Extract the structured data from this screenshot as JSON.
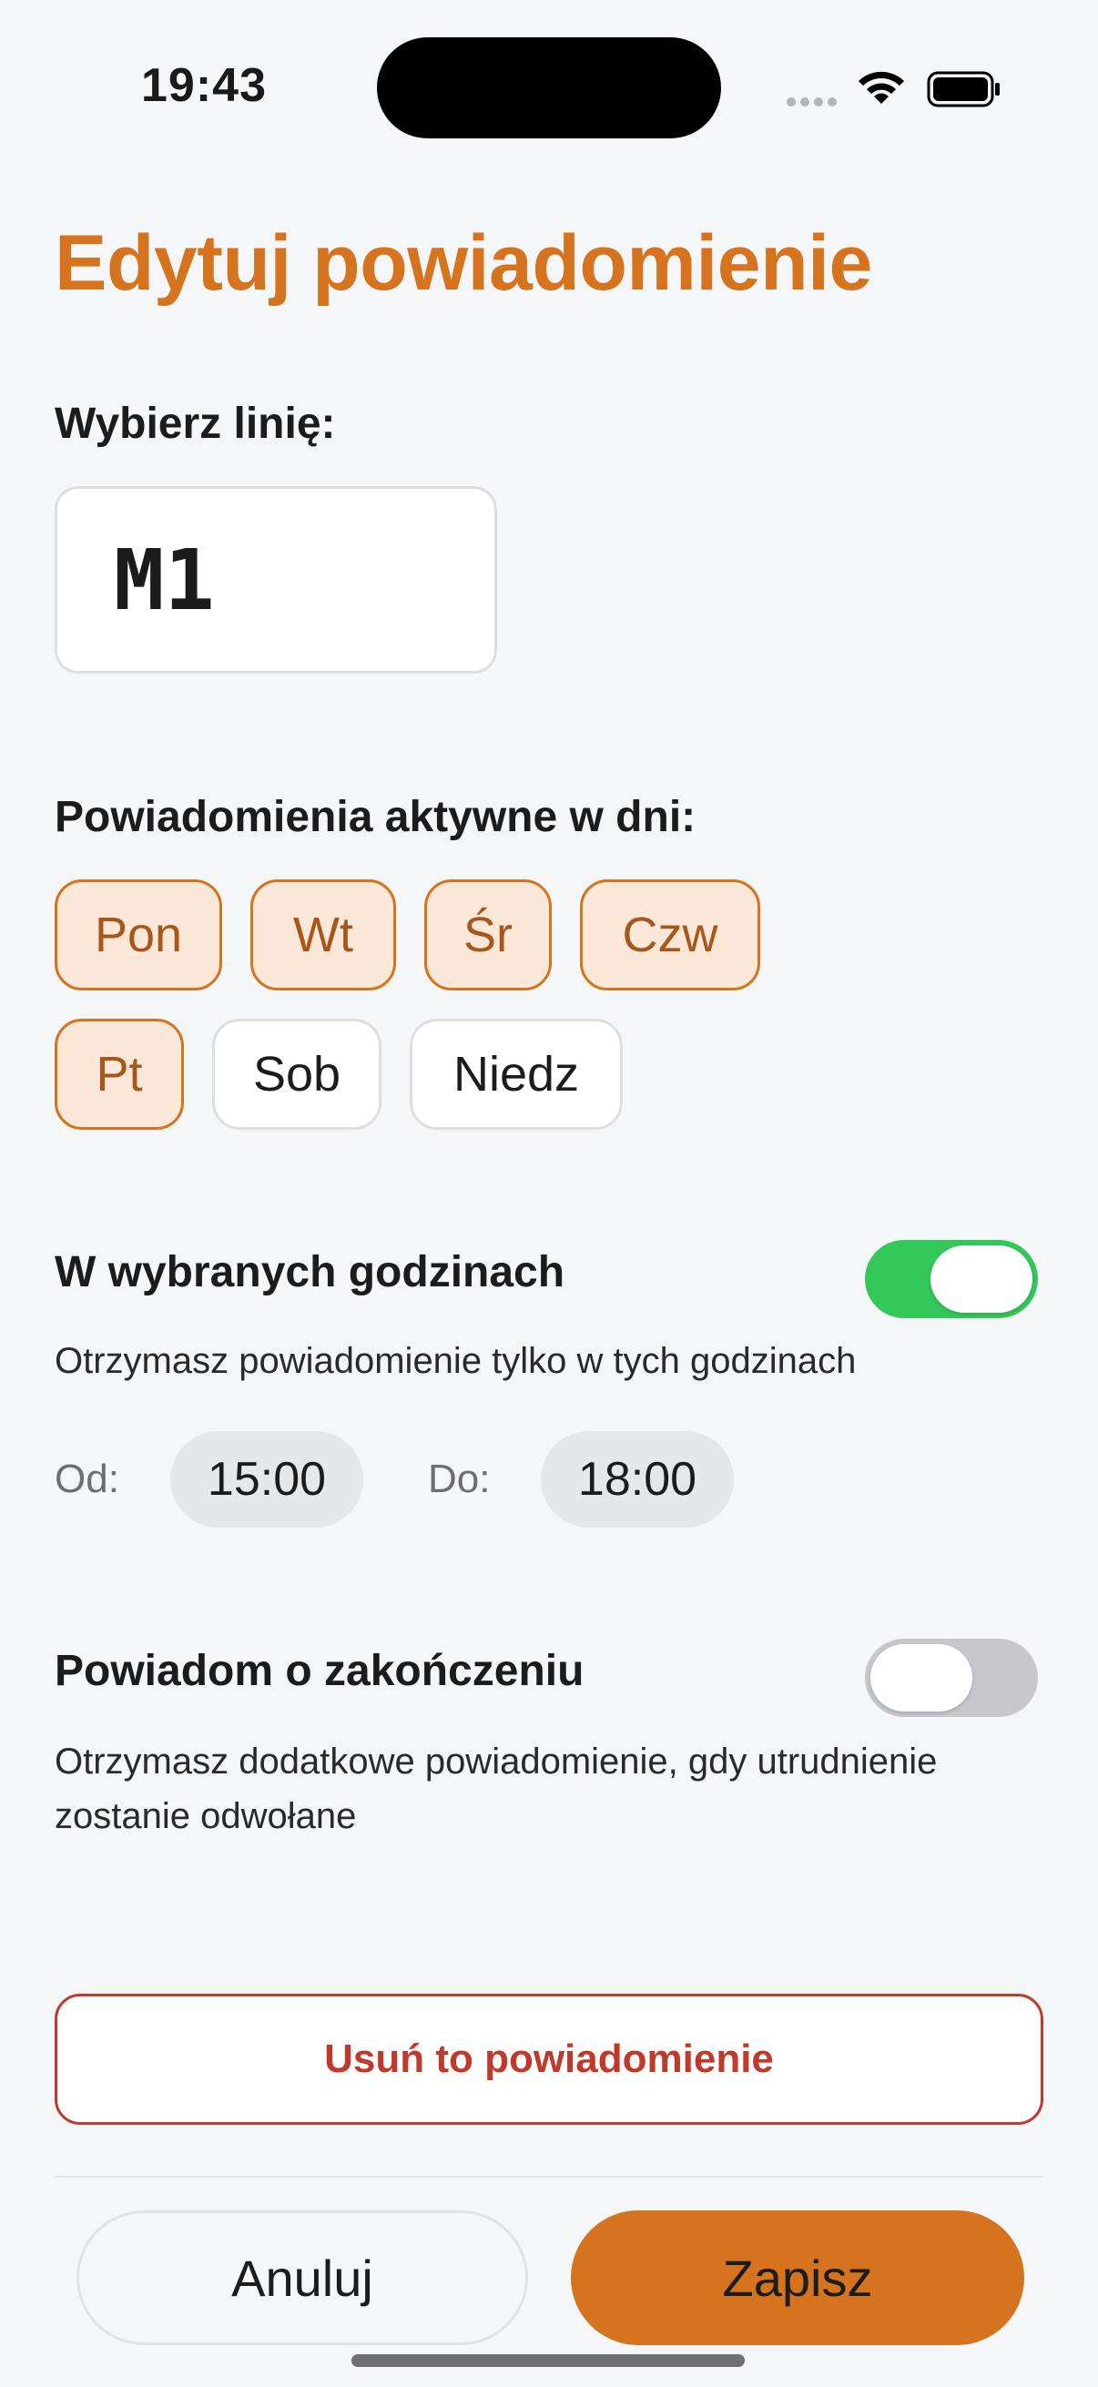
{
  "status_bar": {
    "time": "19:43"
  },
  "page": {
    "title": "Edytuj powiadomienie"
  },
  "line": {
    "label": "Wybierz linię:",
    "value": "M1"
  },
  "days": {
    "label": "Powiadomienia aktywne w dni:",
    "items": [
      {
        "label": "Pon",
        "selected": true
      },
      {
        "label": "Wt",
        "selected": true
      },
      {
        "label": "Śr",
        "selected": true
      },
      {
        "label": "Czw",
        "selected": true
      },
      {
        "label": "Pt",
        "selected": true
      },
      {
        "label": "Sob",
        "selected": false
      },
      {
        "label": "Niedz",
        "selected": false
      }
    ]
  },
  "hours": {
    "title": "W wybranych godzinach",
    "enabled": true,
    "description": "Otrzymasz powiadomienie tylko w tych godzinach",
    "from_label": "Od:",
    "from_value": "15:00",
    "to_label": "Do:",
    "to_value": "18:00"
  },
  "end_notify": {
    "title": "Powiadom o zakończeniu",
    "enabled": false,
    "description": "Otrzymasz dodatkowe powiadomienie, gdy utrudnienie zostanie odwołane"
  },
  "actions": {
    "delete_label": "Usuń to powiadomienie",
    "cancel_label": "Anuluj",
    "save_label": "Zapisz"
  },
  "colors": {
    "accent": "#d6731e",
    "danger": "#c0392b",
    "toggle_on": "#34c759",
    "toggle_off": "#c7c7cc",
    "chip_selected_bg": "#fbe8d8"
  }
}
